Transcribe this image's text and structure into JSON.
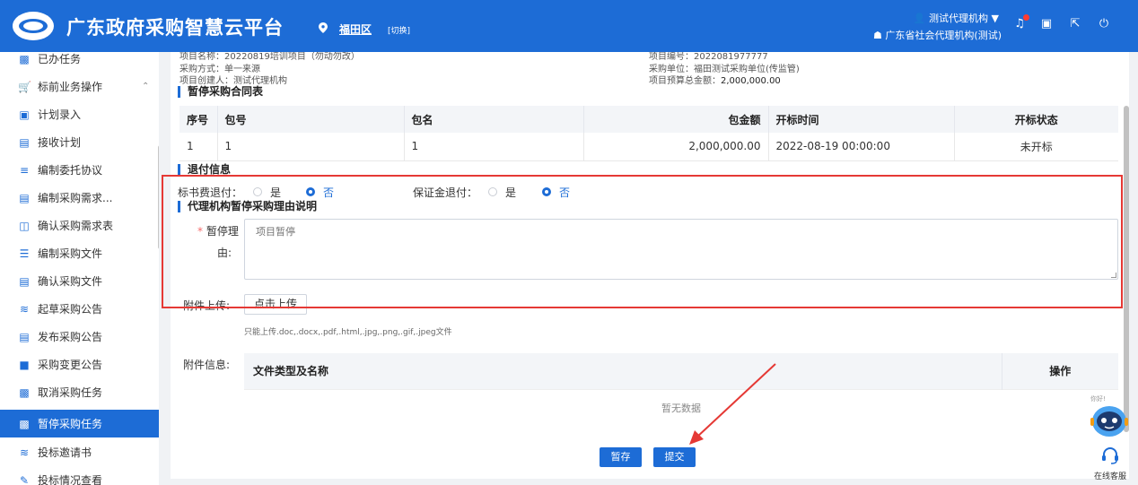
{
  "header": {
    "app_title": "广东政府采购智慧云平台",
    "region": "福田区",
    "switch_label": "[切换]",
    "user_name": "测试代理机构",
    "org_name": "广东省社会代理机构(测试)",
    "icons": [
      "bell-icon",
      "image-icon",
      "fullscreen-icon",
      "power-icon"
    ]
  },
  "sidebar": {
    "items": [
      {
        "label": "已办任务",
        "icon": "done-tasks-icon"
      },
      {
        "label": "标前业务操作",
        "icon": "cart-icon"
      },
      {
        "label": "计划录入",
        "icon": "briefcase-icon"
      },
      {
        "label": "接收计划",
        "icon": "inbox-icon"
      },
      {
        "label": "编制委托协议",
        "icon": "list-icon"
      },
      {
        "label": "编制采购需求...",
        "icon": "doc-list-icon"
      },
      {
        "label": "确认采购需求表",
        "icon": "building-icon"
      },
      {
        "label": "编制采购文件",
        "icon": "sliders-icon"
      },
      {
        "label": "确认采购文件",
        "icon": "file-check-icon"
      },
      {
        "label": "起草采购公告",
        "icon": "layers-icon"
      },
      {
        "label": "发布采购公告",
        "icon": "notice-icon"
      },
      {
        "label": "采购变更公告",
        "icon": "lock-icon"
      },
      {
        "label": "取消采购任务",
        "icon": "printer-icon"
      },
      {
        "label": "暂停采购任务",
        "icon": "printer-icon"
      },
      {
        "label": "投标邀请书",
        "icon": "layers-icon"
      },
      {
        "label": "投标情况查看",
        "icon": "pen-icon"
      }
    ]
  },
  "project": {
    "name_label": "项目名称：",
    "name_value": "20220819培训项目（勿动勿改）",
    "code_label": "项目编号：",
    "code_value": "2022081977777",
    "method_label": "采购方式：",
    "method_value": "单一来源",
    "unit_label": "采购单位：",
    "unit_value": "福田测试采购单位(传监管)",
    "creator_label": "项目创建人：",
    "creator_value": "测试代理机构",
    "budget_label": "项目预算总金额：",
    "budget_value": "2,000,000.00"
  },
  "pause_table": {
    "title": "暂停采购合同表",
    "headers": [
      "序号",
      "包号",
      "包名",
      "包金额",
      "开标时间",
      "开标状态"
    ],
    "rows": [
      [
        "1",
        "1",
        "1",
        "2,000,000.00",
        "2022-08-19 00:00:00",
        "未开标"
      ]
    ]
  },
  "refund": {
    "title": "退付信息",
    "doc_fee_label": "标书费退付：",
    "deposit_label": "保证金退付：",
    "yes": "是",
    "no": "否",
    "doc_fee_value": "否",
    "deposit_value": "否"
  },
  "reason": {
    "title": "代理机构暂停采购理由说明",
    "required_mark": "*",
    "label_line1": "暂停理",
    "label_line2": "由:",
    "placeholder": "项目暂停"
  },
  "attachment": {
    "upload_label": "附件上传:",
    "upload_button": "点击上传",
    "hint": "只能上传.doc,.docx,.pdf,.html,.jpg,.png,.gif,.jpeg文件",
    "info_label": "附件信息:",
    "col_name": "文件类型及名称",
    "col_action": "操作",
    "empty_text": "暂无数据"
  },
  "actions": {
    "save_label": "暂存",
    "submit_label": "提交"
  },
  "widget": {
    "robot_tip": "你好!",
    "service_label": "在线客服"
  },
  "colors": {
    "brand": "#1d6cd6",
    "annotation": "#e53935"
  }
}
